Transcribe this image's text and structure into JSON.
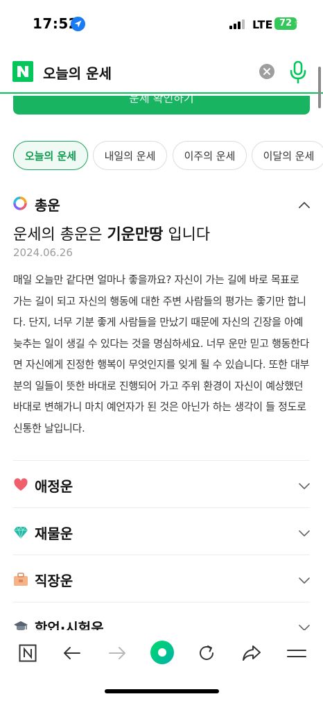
{
  "status_bar": {
    "time": "17:52",
    "network": "LTE",
    "battery": "72"
  },
  "search": {
    "query": "오늘의 운세",
    "brand_color": "#03c75a"
  },
  "cta": {
    "label": "운세 확인하기"
  },
  "tabs": [
    {
      "label": "오늘의 운세",
      "active": true
    },
    {
      "label": "내일의 운세",
      "active": false
    },
    {
      "label": "이주의 운세",
      "active": false
    },
    {
      "label": "이달의 운세",
      "active": false
    }
  ],
  "total_fortune": {
    "title": "총운",
    "headline_prefix": "운세의 총운은 ",
    "headline_bold": "기운만땅",
    "headline_suffix": " 입니다",
    "date": "2024.06.26",
    "body": "매일 오늘만 같다면 얼마나 좋을까요? 자신이 가는 길에 바로 목표로 가는 길이 되고 자신의 행동에 대한 주변 사람들의 평가는 좋기만 합니다. 단지, 너무 기분 좋게 사람들을 만났기 때문에 자신의 긴장을 아예 늦추는 일이 생길 수 있다는 것을 명심하세요. 너무 운만 믿고 행동한다면 자신에게 진정한 행복이 무엇인지를 잊게 될 수 있습니다. 또한 대부분의 일들이 뜻한 바대로 진행되어 가고 주위 환경이 자신이 예상했던 바대로 변해가니 마치 예언자가 된 것은 아닌가 하는 생각이 들 정도로 신통한 날입니다."
  },
  "sections": [
    {
      "label": "애정운",
      "icon": "heart-icon"
    },
    {
      "label": "재물운",
      "icon": "gem-icon"
    },
    {
      "label": "직장운",
      "icon": "briefcase-icon"
    },
    {
      "label": "학업·시험운",
      "icon": "graduation-cap-icon"
    }
  ],
  "bottom_nav": [
    "naver-home-icon",
    "back-arrow-icon",
    "forward-arrow-icon",
    "green-dot-icon",
    "refresh-icon",
    "share-icon",
    "menu-icon"
  ]
}
